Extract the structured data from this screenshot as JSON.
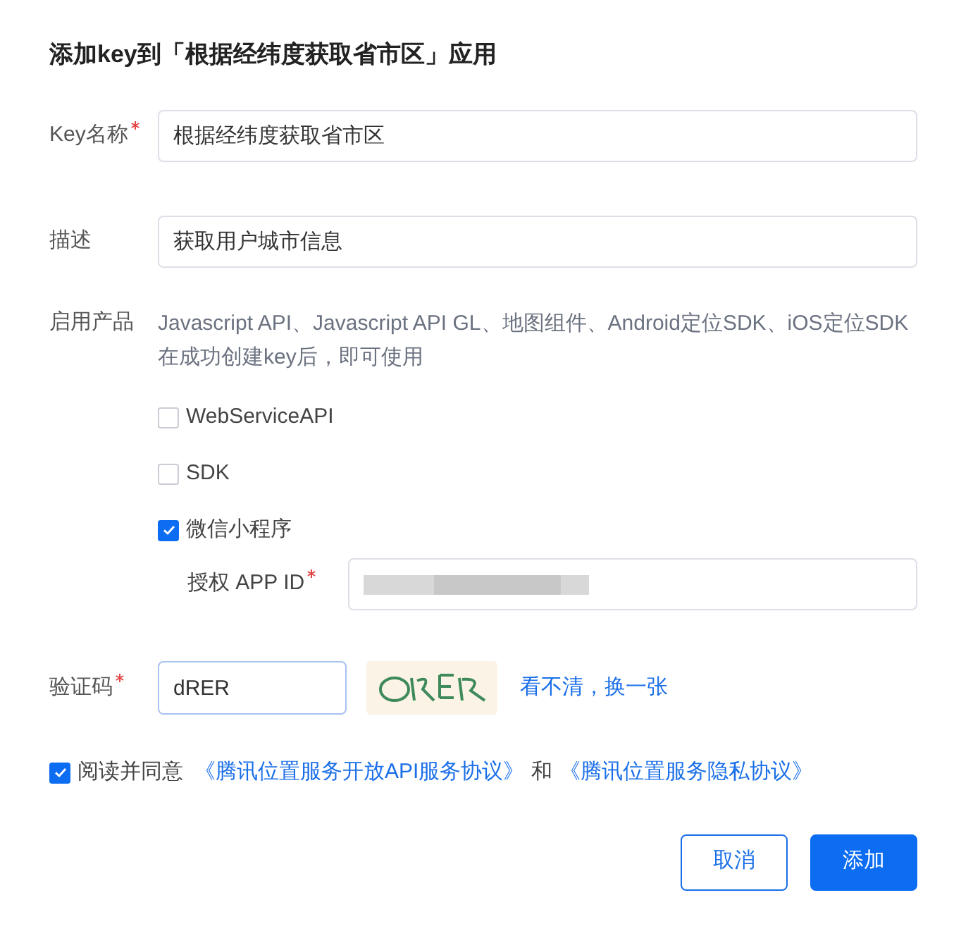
{
  "title": "添加key到「根据经纬度获取省市区」应用",
  "fields": [
    {
      "label": "Key名称",
      "required": true,
      "value": "根据经纬度获取省市区"
    },
    {
      "label": "描述",
      "required": false,
      "value": "获取用户城市信息"
    }
  ],
  "products": {
    "label": "启用产品",
    "note": "Javascript API、Javascript API GL、地图组件、Android定位SDK、iOS定位SDK在成功创建key后，即可使用",
    "options": [
      {
        "label": "WebServiceAPI",
        "checked": false
      },
      {
        "label": "SDK",
        "checked": false
      },
      {
        "label": "微信小程序",
        "checked": true
      }
    ],
    "app_id": {
      "label": "授权 APP ID",
      "required": true
    }
  },
  "captcha": {
    "label": "验证码",
    "required": true,
    "value": "dRER",
    "refresh_link": "看不清，换一张"
  },
  "agreement": {
    "checked": true,
    "text": "阅读并同意",
    "link_1": "《腾讯位置服务开放API服务协议》",
    "joiner": "和",
    "link_2": "《腾讯位置服务隐私协议》"
  },
  "buttons": [
    {
      "label": "取消",
      "kind": "secondary"
    },
    {
      "label": "添加",
      "kind": "primary"
    }
  ]
}
